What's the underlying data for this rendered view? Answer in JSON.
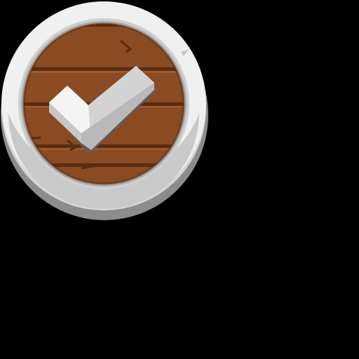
{
  "button": {
    "action": "confirm",
    "icon": "checkmark-icon",
    "state": "enabled"
  },
  "colors": {
    "background": "#000000",
    "rim_light": "#f0f0f0",
    "rim_mid": "#d6d6d6",
    "rim_shadow": "#a9a9a9",
    "rim_dark": "#8c8c8c",
    "wood": "#8a4a22",
    "wood_dark": "#5a2c10",
    "wood_light": "#9a5a2c",
    "check_light": "#f4f4f4",
    "check_shade": "#d3d3d3",
    "check_shadow": "#5f5f5f"
  }
}
